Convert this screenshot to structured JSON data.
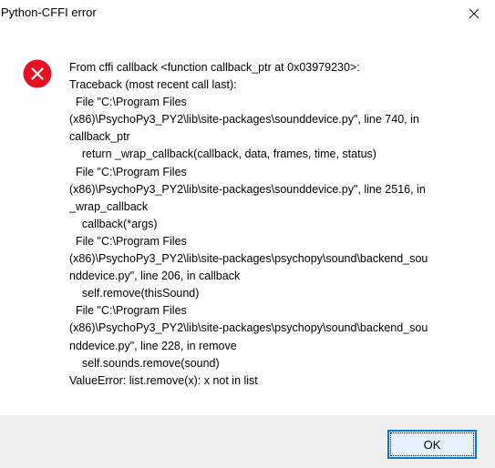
{
  "window": {
    "title": "Python-CFFI error",
    "close_icon": "close-icon"
  },
  "dialog": {
    "icon": "error-icon",
    "icon_color": "#e81123",
    "message_lines": [
      "From cffi callback <function callback_ptr at 0x03979230>:",
      "Traceback (most recent call last):",
      "  File \"C:\\Program Files",
      "(x86)\\PsychoPy3_PY2\\lib\\site-packages\\sounddevice.py\", line 740, in",
      "callback_ptr",
      "    return _wrap_callback(callback, data, frames, time, status)",
      "  File \"C:\\Program Files",
      "(x86)\\PsychoPy3_PY2\\lib\\site-packages\\sounddevice.py\", line 2516, in",
      "_wrap_callback",
      "    callback(*args)",
      "  File \"C:\\Program Files",
      "(x86)\\PsychoPy3_PY2\\lib\\site-packages\\psychopy\\sound\\backend_sou",
      "nddevice.py\", line 206, in callback",
      "    self.remove(thisSound)",
      "  File \"C:\\Program Files",
      "(x86)\\PsychoPy3_PY2\\lib\\site-packages\\psychopy\\sound\\backend_sou",
      "nddevice.py\", line 228, in remove",
      "    self.sounds.remove(sound)",
      "ValueError: list.remove(x): x not in list"
    ]
  },
  "buttons": {
    "ok_label": "OK",
    "accent_color": "#0078d7"
  },
  "footer": {
    "background": "#f0f0f0"
  }
}
